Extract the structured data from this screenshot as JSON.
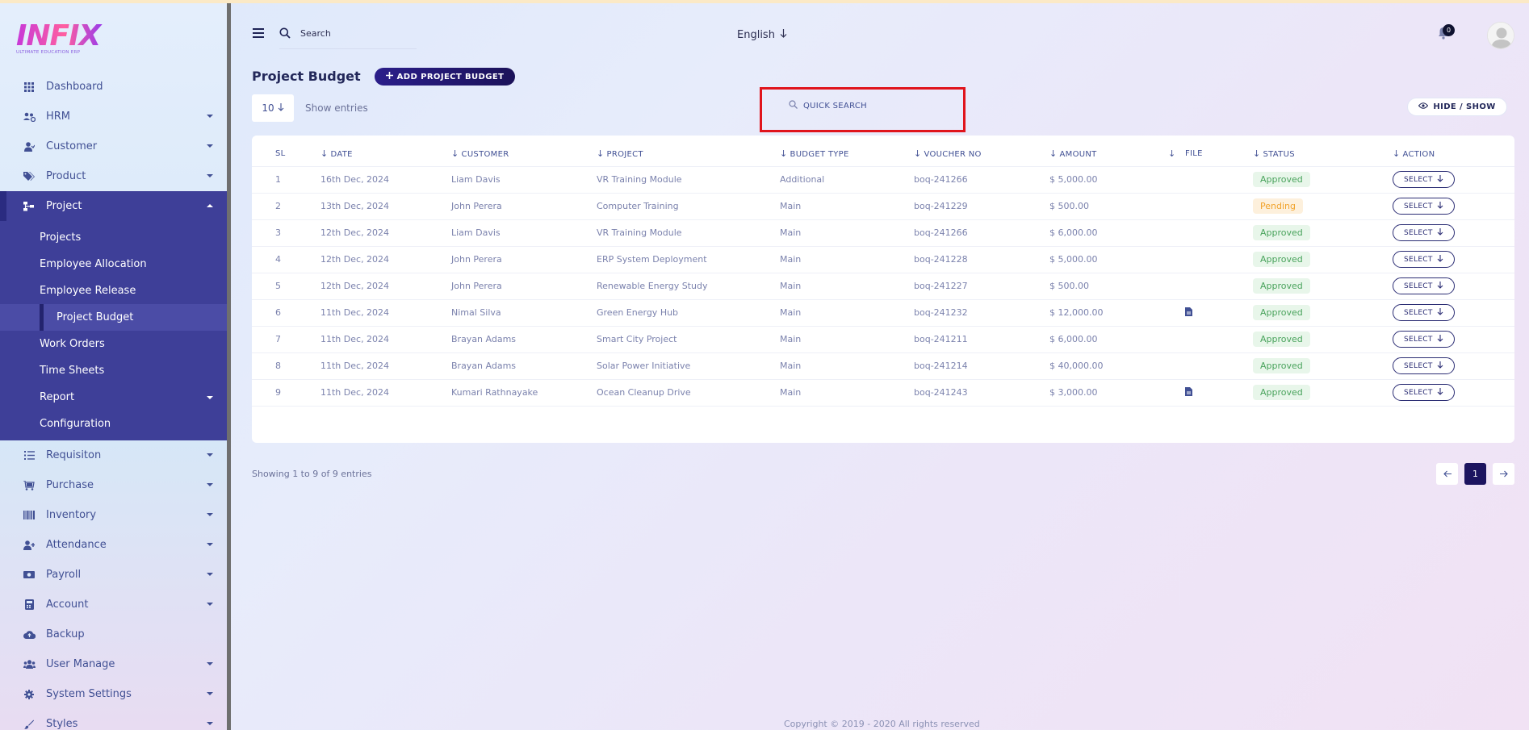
{
  "brand": {
    "name": "INFIX",
    "tagline": "ULTIMATE EDUCATION ERP"
  },
  "header": {
    "search_label": "Search",
    "language": "English",
    "notification_count": "0"
  },
  "sidebar": {
    "items": [
      {
        "label": "Dashboard",
        "icon": "dashboard-icon"
      },
      {
        "label": "HRM",
        "icon": "users-cog-icon"
      },
      {
        "label": "Customer",
        "icon": "user-icon"
      },
      {
        "label": "Product",
        "icon": "tags-icon"
      },
      {
        "label": "Project",
        "icon": "sitemap-icon"
      },
      {
        "label": "Requisiton",
        "icon": "list-icon"
      },
      {
        "label": "Purchase",
        "icon": "cart-icon"
      },
      {
        "label": "Inventory",
        "icon": "barcode-icon"
      },
      {
        "label": "Attendance",
        "icon": "user-plus-icon"
      },
      {
        "label": "Payroll",
        "icon": "money-icon"
      },
      {
        "label": "Account",
        "icon": "calculator-icon"
      },
      {
        "label": "Backup",
        "icon": "cloud-icon"
      },
      {
        "label": "User Manage",
        "icon": "users-icon"
      },
      {
        "label": "System Settings",
        "icon": "gear-icon"
      },
      {
        "label": "Styles",
        "icon": "brush-icon"
      }
    ],
    "project_sub": [
      "Projects",
      "Employee Allocation",
      "Employee Release",
      "Project Budget",
      "Work Orders",
      "Time Sheets",
      "Report",
      "Configuration"
    ]
  },
  "page": {
    "title": "Project Budget",
    "add_button": "ADD PROJECT BUDGET",
    "entries_value": "10",
    "entries_label": "Show entries",
    "quick_search": "QUICK SEARCH",
    "hide_show": "HIDE / SHOW"
  },
  "table": {
    "columns": [
      "SL",
      "DATE",
      "CUSTOMER",
      "PROJECT",
      "BUDGET TYPE",
      "VOUCHER NO",
      "AMOUNT",
      "",
      "FILE",
      "STATUS",
      "ACTION"
    ],
    "rows": [
      {
        "sl": "1",
        "date": "16th Dec, 2024",
        "customer": "Liam Davis",
        "project": "VR Training Module",
        "type": "Additional",
        "voucher": "boq-241266",
        "amount": "$ 5,000.00",
        "file": false,
        "status": "Approved"
      },
      {
        "sl": "2",
        "date": "13th Dec, 2024",
        "customer": "John Perera",
        "project": "Computer Training",
        "type": "Main",
        "voucher": "boq-241229",
        "amount": "$ 500.00",
        "file": false,
        "status": "Pending"
      },
      {
        "sl": "3",
        "date": "12th Dec, 2024",
        "customer": "Liam Davis",
        "project": "VR Training Module",
        "type": "Main",
        "voucher": "boq-241266",
        "amount": "$ 6,000.00",
        "file": false,
        "status": "Approved"
      },
      {
        "sl": "4",
        "date": "12th Dec, 2024",
        "customer": "John Perera",
        "project": "ERP System Deployment",
        "type": "Main",
        "voucher": "boq-241228",
        "amount": "$ 5,000.00",
        "file": false,
        "status": "Approved"
      },
      {
        "sl": "5",
        "date": "12th Dec, 2024",
        "customer": "John Perera",
        "project": "Renewable Energy Study",
        "type": "Main",
        "voucher": "boq-241227",
        "amount": "$ 500.00",
        "file": false,
        "status": "Approved"
      },
      {
        "sl": "6",
        "date": "11th Dec, 2024",
        "customer": "Nimal Silva",
        "project": "Green Energy Hub",
        "type": "Main",
        "voucher": "boq-241232",
        "amount": "$ 12,000.00",
        "file": true,
        "status": "Approved"
      },
      {
        "sl": "7",
        "date": "11th Dec, 2024",
        "customer": "Brayan Adams",
        "project": "Smart City Project",
        "type": "Main",
        "voucher": "boq-241211",
        "amount": "$ 6,000.00",
        "file": false,
        "status": "Approved"
      },
      {
        "sl": "8",
        "date": "11th Dec, 2024",
        "customer": "Brayan Adams",
        "project": "Solar Power Initiative",
        "type": "Main",
        "voucher": "boq-241214",
        "amount": "$ 40,000.00",
        "file": false,
        "status": "Approved"
      },
      {
        "sl": "9",
        "date": "11th Dec, 2024",
        "customer": "Kumari Rathnayake",
        "project": "Ocean Cleanup Drive",
        "type": "Main",
        "voucher": "boq-241243",
        "amount": "$ 3,000.00",
        "file": true,
        "status": "Approved"
      }
    ],
    "select_label": "SELECT"
  },
  "pagination": {
    "showing": "Showing 1 to 9 of 9 entries",
    "current": "1"
  },
  "footer": {
    "copyright": "Copyright © 2019 - 2020 All rights reserved"
  },
  "colors": {
    "primary": "#415094",
    "accent": "#3e3f98",
    "highlight": "#e0141c"
  }
}
